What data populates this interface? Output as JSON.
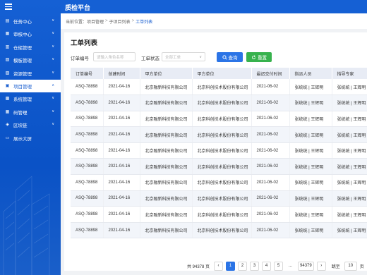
{
  "app_title": "质检平台",
  "breadcrumb": {
    "prefix": "当前位置：",
    "items": [
      "项目管理",
      "子项目列表"
    ],
    "current": "工单列表",
    "separator": ">"
  },
  "sidebar": {
    "items": [
      {
        "label": "任务中心",
        "icon": "task-icon",
        "chevron": "∨"
      },
      {
        "label": "审核中心",
        "icon": "audit-icon",
        "chevron": "∨"
      },
      {
        "label": "仓储管理",
        "icon": "warehouse-icon",
        "chevron": "∨"
      },
      {
        "label": "模板管理",
        "icon": "template-icon",
        "chevron": "∨"
      },
      {
        "label": "资源管理",
        "icon": "resource-icon",
        "chevron": "∨"
      },
      {
        "label": "项目管理",
        "icon": "project-icon",
        "chevron": "∧",
        "active": true
      },
      {
        "label": "系统管理",
        "icon": "system-icon",
        "chevron": "∨"
      },
      {
        "label": "码管理",
        "icon": "code-icon",
        "chevron": "∨"
      },
      {
        "label": "区块链",
        "icon": "blockchain-icon",
        "chevron": "∨"
      },
      {
        "label": "展示大屏",
        "icon": "screen-icon",
        "chevron": ""
      }
    ]
  },
  "page_title": "工单列表",
  "filters": {
    "order_no_label": "订单编号",
    "order_no_placeholder": "请输入角色名称",
    "status_label": "工单状态",
    "status_value": "全部工单",
    "query_label": "查询",
    "reset_label": "重置"
  },
  "table": {
    "columns": [
      "订单编号",
      "创建时间",
      "甲方单位",
      "甲方单位",
      "最迟交付时间",
      "指派人员",
      "指导专家"
    ],
    "rows": [
      [
        "ASQ-78898",
        "2021-04-16",
        "北京融新科技有限公司",
        "北京科创技术股份有限公司",
        "2021-06-02",
        "张统统 | 王辉明",
        "张统统 | 王辉明"
      ],
      [
        "ASQ-78898",
        "2021-04-16",
        "北京融新科技有限公司",
        "北京科创技术股份有限公司",
        "2021-06-02",
        "张统统 | 王辉明",
        "张统统 | 王辉明"
      ],
      [
        "ASQ-78898",
        "2021-04-16",
        "北京融新科技有限公司",
        "北京科创技术股份有限公司",
        "2021-06-02",
        "张统统 | 王辉明",
        "张统统 | 王辉明"
      ],
      [
        "ASQ-78898",
        "2021-04-16",
        "北京融新科技有限公司",
        "北京科创技术股份有限公司",
        "2021-06-02",
        "张统统 | 王辉明",
        "张统统 | 王辉明"
      ],
      [
        "ASQ-78898",
        "2021-04-16",
        "北京融新科技有限公司",
        "北京科创技术股份有限公司",
        "2021-06-02",
        "张统统 | 王辉明",
        "张统统 | 王辉明"
      ],
      [
        "ASQ-78898",
        "2021-04-16",
        "北京融新科技有限公司",
        "北京科创技术股份有限公司",
        "2021-06-02",
        "张统统 | 王辉明",
        "张统统 | 王辉明"
      ],
      [
        "ASQ-78898",
        "2021-04-16",
        "北京融新科技有限公司",
        "北京科创技术股份有限公司",
        "2021-06-02",
        "张统统 | 王辉明",
        "张统统 | 王辉明"
      ],
      [
        "ASQ-78898",
        "2021-04-16",
        "北京融新科技有限公司",
        "北京科创技术股份有限公司",
        "2021-06-02",
        "张统统 | 王辉明",
        "张统统 | 王辉明"
      ],
      [
        "ASQ-78898",
        "2021-04-16",
        "北京融新科技有限公司",
        "北京科创技术股份有限公司",
        "2021-06-02",
        "张统统 | 王辉明",
        "张统统 | 王辉明"
      ],
      [
        "ASQ-78898",
        "2021-04-16",
        "北京融新科技有限公司",
        "北京科创技术股份有限公司",
        "2021-06-02",
        "张统统 | 王辉明",
        "张统统 | 王辉明"
      ]
    ]
  },
  "pagination": {
    "total_text": "共 94378 页",
    "pages": [
      "1",
      "2",
      "3",
      "4",
      "5",
      "...",
      "94379"
    ],
    "current_page": "1",
    "prev": "‹",
    "next": "›",
    "jump_label": "跳至",
    "jump_value": "10",
    "page_unit": "页"
  },
  "colors": {
    "primary": "#1560d4",
    "query_button": "#2b74e6",
    "reset_button": "#37b24d"
  }
}
